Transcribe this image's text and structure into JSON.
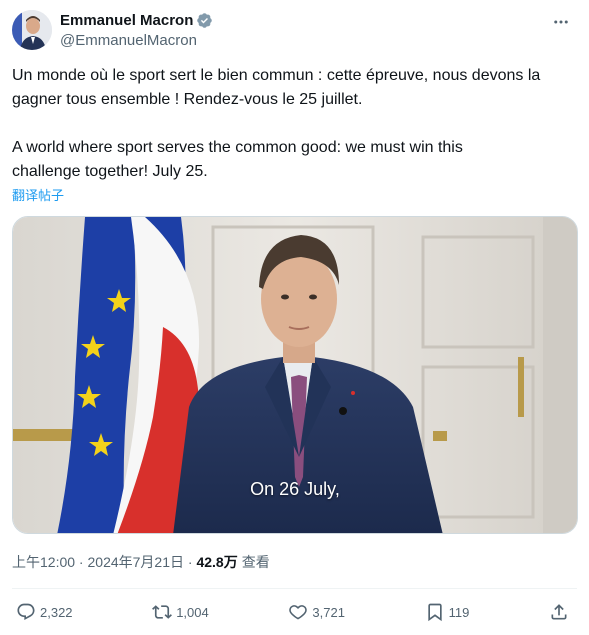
{
  "author": {
    "display_name": "Emmanuel Macron",
    "handle": "@EmmanuelMacron"
  },
  "tweet": {
    "text_fr": "Un monde où le sport sert le bien commun : cette épreuve, nous devons la gagner tous ensemble ! Rendez-vous le 25 juillet.",
    "text_en": "A world where sport serves the common good: we must win this challenge together! July 25.",
    "translate_label": "翻译帖子"
  },
  "video": {
    "subtitle": "On 26 July,"
  },
  "meta": {
    "time": "上午12:00",
    "separator1": " · ",
    "date": "2024年7月21日",
    "separator2": " · ",
    "views_count": "42.8万",
    "views_label": "查看"
  },
  "actions": {
    "replies": "2,322",
    "reposts": "1,004",
    "likes": "3,721",
    "bookmarks": "119"
  },
  "colors": {
    "accent": "#1d9bf0",
    "text_primary": "#0f1419",
    "text_secondary": "#536471",
    "flag_blue": "#1d3fa6",
    "flag_red": "#d8302c"
  }
}
